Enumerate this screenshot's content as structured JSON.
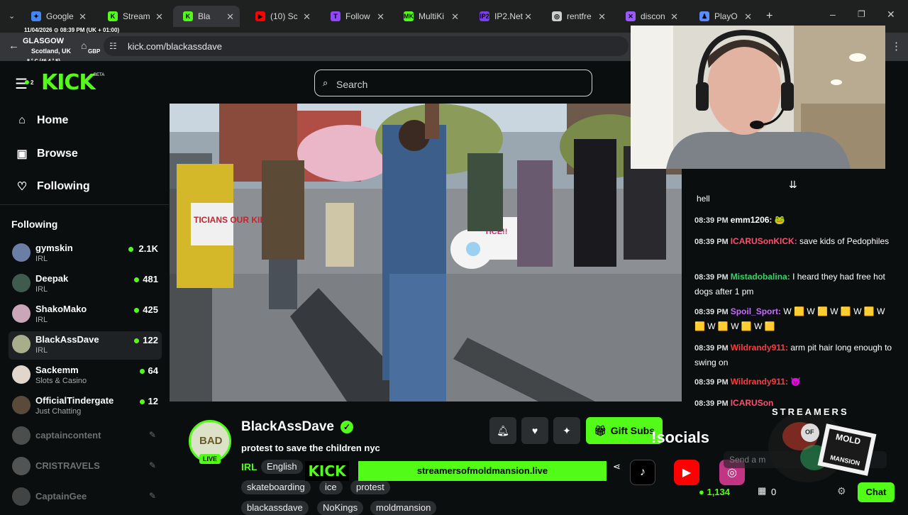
{
  "browser": {
    "tabs": [
      {
        "label": "Google",
        "fav_color": "#4285f4",
        "fav_text": "✦"
      },
      {
        "label": "Stream",
        "fav_color": "#53fc18",
        "fav_text": "K"
      },
      {
        "label": "Bla",
        "fav_color": "#53fc18",
        "fav_text": "K",
        "active": true
      },
      {
        "label": "(10) Sc",
        "fav_color": "#ff0000",
        "fav_text": "▶"
      },
      {
        "label": "Follow",
        "fav_color": "#9146ff",
        "fav_text": "T"
      },
      {
        "label": "MultiKi",
        "fav_color": "#53fc18",
        "fav_text": "MK"
      },
      {
        "label": "IP2.Net",
        "fav_color": "#7b3fe4",
        "fav_text": "IP2"
      },
      {
        "label": "rentfre",
        "fav_color": "#cfcfcf",
        "fav_text": "◎"
      },
      {
        "label": "discon",
        "fav_color": "#9b59ff",
        "fav_text": "✕"
      },
      {
        "label": "PlayO",
        "fav_color": "#5b8cff",
        "fav_text": "♟"
      }
    ],
    "url": "kick.com/blackassdave"
  },
  "overlay": {
    "date_time": "11/04/2026  ⊙ 08:39 PM (UK + 01:00)",
    "city": "GLASGOW",
    "region": "Scotland, UK",
    "currency": "GBP",
    "weather": "8 ° C (46.4 ° F)"
  },
  "header": {
    "notif_count": "2",
    "logo": "KICK",
    "beta": "BETA",
    "search_placeholder": "Search"
  },
  "nav": {
    "home": "Home",
    "browse": "Browse",
    "following": "Following"
  },
  "following": {
    "heading": "Following",
    "channels": [
      {
        "name": "gymskin",
        "category": "IRL",
        "viewers": "2.1K",
        "avatar": "#6b7ea5"
      },
      {
        "name": "Deepak",
        "category": "IRL",
        "viewers": "481",
        "avatar": "#3f5a4f"
      },
      {
        "name": "ShakoMako",
        "category": "IRL",
        "viewers": "425",
        "avatar": "#c9a7b8"
      },
      {
        "name": "BlackAssDave",
        "category": "IRL",
        "viewers": "122",
        "avatar": "#a8ae8b"
      },
      {
        "name": "Sackemm",
        "category": "Slots & Casino",
        "viewers": "64",
        "avatar": "#e0d6cc"
      },
      {
        "name": "OfficialTindergate",
        "category": "Just Chatting",
        "viewers": "12",
        "avatar": "#5a4a3a"
      }
    ],
    "offline": [
      {
        "name": "captaincontent",
        "avatar": "#8d8d8d"
      },
      {
        "name": "CRISTRAVELS",
        "avatar": "#9a9a9a"
      },
      {
        "name": "CaptainGee",
        "avatar": "#7a7a7a"
      }
    ]
  },
  "video": {
    "sign_left": "TICIANS OUR KIDS",
    "sign_right": "TICE!!"
  },
  "chat": {
    "messages": [
      {
        "time": "",
        "user": "",
        "user_color": "#ffffff",
        "text": "hell"
      },
      {
        "time": "08:39 PM",
        "user": "emm1206:",
        "user_color": "#ffffff",
        "text": "🐸"
      },
      {
        "time": "08:39 PM",
        "user": "ICARUSonKICK:",
        "user_color": "#ff4f6d",
        "text": "save kids of Pedophiles"
      },
      {
        "time": "08:39 PM",
        "user": "Mistadobalina:",
        "user_color": "#35d46a",
        "text": "I heard they had free hot dogs after 1 pm"
      },
      {
        "time": "08:39 PM",
        "user": "Spoil_Sport:",
        "user_color": "#c86bff",
        "text": "W 🟨 W 🟨 W 🟨 W 🟨 W 🟨 W 🟨 W 🟨 W 🟨"
      },
      {
        "time": "08:39 PM",
        "user": "Wildrandy911:",
        "user_color": "#ff3b3b",
        "text": "arm pit hair long enough to swing on"
      },
      {
        "time": "08:39 PM",
        "user": "Wildrandy911:",
        "user_color": "#ff3b3b",
        "text": "😈"
      },
      {
        "time": "08:39 PM",
        "user": "ICARUSon",
        "user_color": "#ff4f6d",
        "text": ""
      }
    ],
    "send_placeholder": "Send a m",
    "viewers": "1,134",
    "kicks": "0",
    "chat_button": "Chat"
  },
  "channel": {
    "avatar_text": "BAD",
    "live": "LIVE",
    "name": "BlackAssDave",
    "stream_title": "protest to save the children nyc",
    "category": "IRL",
    "language": "English",
    "tags": [
      "skateboarding",
      "ice",
      "protest"
    ],
    "tags2": [
      "blackassdave",
      "NoKings",
      "moldmansion"
    ],
    "gift_subs": "Gift Subs"
  },
  "stream_overlay": {
    "kick": "KICK",
    "site": "streamersofmoldmansion.live",
    "socials": "!socials",
    "streamers_title": "STREAMERS",
    "of": "OF",
    "mold": "MOLD",
    "mansion": "MANSION"
  },
  "colors": {
    "kick_green": "#53fc18",
    "bg": "#0b0e0f",
    "sidebar_sel": "#1f2224"
  }
}
